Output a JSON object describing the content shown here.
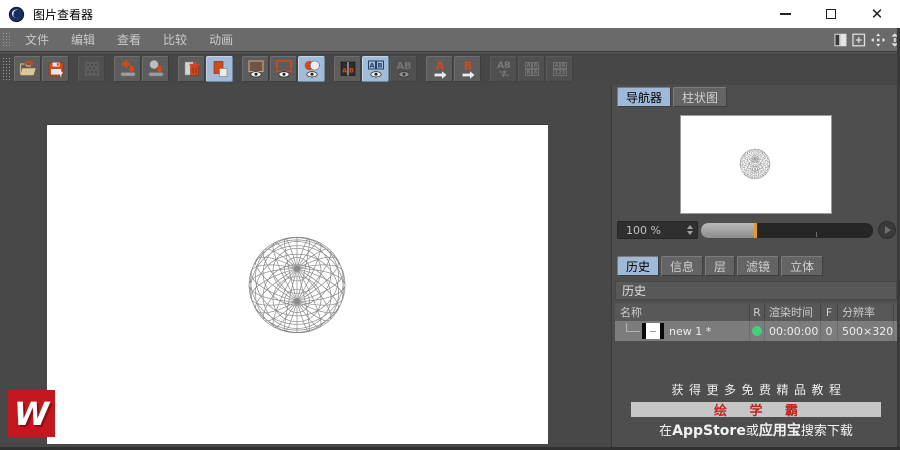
{
  "window": {
    "title": "图片查看器"
  },
  "menu": {
    "items": [
      "文件",
      "编辑",
      "查看",
      "比较",
      "动画"
    ]
  },
  "toolbar": {
    "groups": [
      [
        {
          "name": "open",
          "state": "normal"
        },
        {
          "name": "save",
          "state": "normal"
        }
      ],
      [
        {
          "name": "cache",
          "state": "disabled"
        }
      ],
      [
        {
          "name": "layer-down",
          "state": "normal"
        },
        {
          "name": "object-down",
          "state": "normal"
        }
      ],
      [
        {
          "name": "delete-image",
          "state": "normal"
        },
        {
          "name": "duplicate-image",
          "state": "active"
        }
      ],
      [
        {
          "name": "view-a",
          "state": "normal"
        },
        {
          "name": "view-b",
          "state": "normal"
        },
        {
          "name": "compare-ab",
          "state": "active"
        }
      ],
      [
        {
          "name": "split-ab",
          "state": "normal"
        },
        {
          "name": "overlay-ab",
          "state": "active"
        },
        {
          "name": "onion-ab",
          "state": "disabled"
        }
      ],
      [
        {
          "name": "set-a",
          "state": "normal"
        },
        {
          "name": "set-b",
          "state": "normal"
        }
      ],
      [
        {
          "name": "swap-ab",
          "state": "disabled"
        },
        {
          "name": "grid-ab",
          "state": "disabled"
        },
        {
          "name": "grid-frames",
          "state": "disabled"
        }
      ]
    ]
  },
  "navigator": {
    "tabs": [
      "导航器",
      "柱状图"
    ],
    "active_tab": "导航器",
    "zoom_value": "100 %"
  },
  "detail": {
    "tabs": [
      "历史",
      "信息",
      "层",
      "滤镜",
      "立体"
    ],
    "active_tab": "历史",
    "section_title": "历史"
  },
  "history": {
    "columns": [
      "名称",
      "R",
      "渲染时间",
      "F",
      "分辨率"
    ],
    "rows": [
      {
        "name": "new 1 *",
        "status_color": "#3fd17e",
        "render_time": "00:00:00",
        "frame": "0",
        "resolution": "500×320"
      }
    ]
  },
  "ad": {
    "line1": "获得更多免费精品教程",
    "brand": "绘 学 霸",
    "line3": {
      "prefix": "在",
      "appstore": "AppStore",
      "or": "或",
      "store": "应用宝",
      "suffix": "搜索下载"
    },
    "brand_color": "#c1261f"
  },
  "watermark": {
    "letter": "W",
    "color": "#c4171d"
  },
  "colors": {
    "accent_orange": "#d2491e",
    "active_bg": "#a2bcd8",
    "status_green": "#3fd17e"
  }
}
